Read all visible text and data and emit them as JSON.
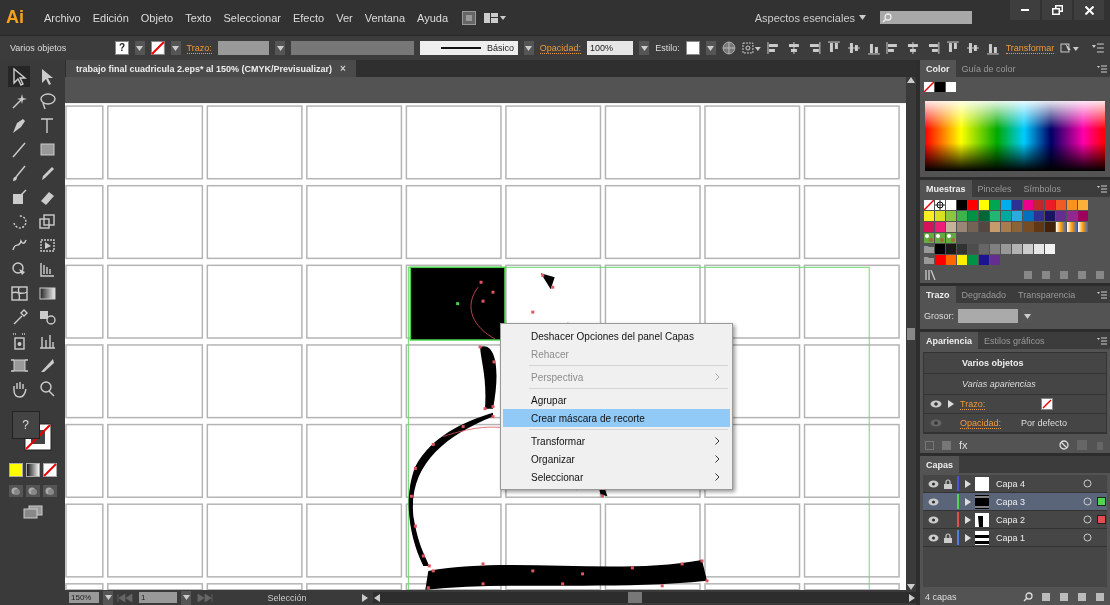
{
  "app_logo": "Ai",
  "menu": [
    "Archivo",
    "Edición",
    "Objeto",
    "Texto",
    "Seleccionar",
    "Efecto",
    "Ver",
    "Ventana",
    "Ayuda"
  ],
  "workspace": "Aspectos esenciales",
  "control_bar": {
    "selection": "Varios objetos",
    "fill_unknown": "?",
    "stroke_label": "Trazo:",
    "profile": "Básico",
    "opacity_label": "Opacidad:",
    "opacity": "100%",
    "style_label": "Estilo:",
    "transform": "Transformar"
  },
  "document_tab": {
    "title": "trabajo final cuadricula 2.eps* al 150% (CMYK/Previsualizar)",
    "close": "×"
  },
  "toolbar": {
    "fill_unknown": "?"
  },
  "context_menu": [
    {
      "kind": "item",
      "label": "Deshacer Opciones del panel Capas",
      "disabled": false,
      "submenu": false,
      "selected": false
    },
    {
      "kind": "item",
      "label": "Rehacer",
      "disabled": true,
      "submenu": false,
      "selected": false
    },
    {
      "kind": "separator"
    },
    {
      "kind": "item",
      "label": "Perspectiva",
      "disabled": true,
      "submenu": true,
      "selected": false
    },
    {
      "kind": "separator"
    },
    {
      "kind": "item",
      "label": "Agrupar",
      "disabled": false,
      "submenu": false,
      "selected": false
    },
    {
      "kind": "item",
      "label": "Crear máscara de recorte",
      "disabled": false,
      "submenu": false,
      "selected": true
    },
    {
      "kind": "separator"
    },
    {
      "kind": "item",
      "label": "Transformar",
      "disabled": false,
      "submenu": true,
      "selected": false
    },
    {
      "kind": "item",
      "label": "Organizar",
      "disabled": false,
      "submenu": true,
      "selected": false
    },
    {
      "kind": "item",
      "label": "Seleccionar",
      "disabled": false,
      "submenu": true,
      "selected": false
    }
  ],
  "color_panel": {
    "tabs": [
      {
        "label": "Color",
        "selected": true
      },
      {
        "label": "Guía de color",
        "selected": false
      }
    ]
  },
  "swatches_panel": {
    "tabs": [
      {
        "label": "Muestras",
        "selected": true
      },
      {
        "label": "Pinceles",
        "selected": false
      },
      {
        "label": "Símbolos",
        "selected": false
      }
    ],
    "rows": [
      [
        {
          "kind": "none"
        },
        {
          "kind": "registration"
        },
        {
          "kind": "color",
          "color": "#ffffff"
        },
        {
          "kind": "color",
          "color": "#000000"
        },
        {
          "kind": "color",
          "color": "#ff0000"
        },
        {
          "kind": "color",
          "color": "#ffff00"
        },
        {
          "kind": "color",
          "color": "#00a651"
        },
        {
          "kind": "color",
          "color": "#00aeef"
        },
        {
          "kind": "color",
          "color": "#2e3192"
        },
        {
          "kind": "color",
          "color": "#ec008c"
        },
        {
          "kind": "color",
          "color": "#c1272d"
        },
        {
          "kind": "color",
          "color": "#ed1c24"
        },
        {
          "kind": "color",
          "color": "#f15a24"
        },
        {
          "kind": "color",
          "color": "#f7931e"
        },
        {
          "kind": "color",
          "color": "#fbb03b"
        }
      ],
      [
        {
          "kind": "color",
          "color": "#fcee21"
        },
        {
          "kind": "color",
          "color": "#d9e021"
        },
        {
          "kind": "color",
          "color": "#8cc63f"
        },
        {
          "kind": "color",
          "color": "#39b54a"
        },
        {
          "kind": "color",
          "color": "#009245"
        },
        {
          "kind": "color",
          "color": "#006837"
        },
        {
          "kind": "color",
          "color": "#22b573"
        },
        {
          "kind": "color",
          "color": "#00a99d"
        },
        {
          "kind": "color",
          "color": "#29abe2"
        },
        {
          "kind": "color",
          "color": "#0071bc"
        },
        {
          "kind": "color",
          "color": "#2e3192"
        },
        {
          "kind": "color",
          "color": "#1b1464"
        },
        {
          "kind": "color",
          "color": "#662d91"
        },
        {
          "kind": "color",
          "color": "#93278f"
        },
        {
          "kind": "color",
          "color": "#9e005d"
        }
      ],
      [
        {
          "kind": "color",
          "color": "#d4145a"
        },
        {
          "kind": "color",
          "color": "#ed1e79"
        },
        {
          "kind": "color",
          "color": "#c7b299"
        },
        {
          "kind": "color",
          "color": "#998675"
        },
        {
          "kind": "color",
          "color": "#736357"
        },
        {
          "kind": "color",
          "color": "#534741"
        },
        {
          "kind": "color",
          "color": "#c69c6d"
        },
        {
          "kind": "color",
          "color": "#a67c52"
        },
        {
          "kind": "color",
          "color": "#8c6239"
        },
        {
          "kind": "color",
          "color": "#754c24"
        },
        {
          "kind": "color",
          "color": "#603813"
        },
        {
          "kind": "color",
          "color": "#42210b"
        },
        {
          "kind": "gradient"
        },
        {
          "kind": "gradient"
        },
        {
          "kind": "gradient"
        }
      ],
      [
        {
          "kind": "pattern"
        },
        {
          "kind": "pattern"
        },
        {
          "kind": "pattern"
        }
      ],
      [
        {
          "kind": "folder"
        },
        {
          "kind": "color",
          "color": "#000000"
        },
        {
          "kind": "color",
          "color": "#1a1a1a"
        },
        {
          "kind": "color",
          "color": "#333333"
        },
        {
          "kind": "color",
          "color": "#4d4d4d"
        },
        {
          "kind": "color",
          "color": "#666666"
        },
        {
          "kind": "color",
          "color": "#808080"
        },
        {
          "kind": "color",
          "color": "#999999"
        },
        {
          "kind": "color",
          "color": "#b3b3b3"
        },
        {
          "kind": "color",
          "color": "#cccccc"
        },
        {
          "kind": "color",
          "color": "#e6e6e6"
        },
        {
          "kind": "color",
          "color": "#f2f2f2"
        }
      ],
      [
        {
          "kind": "folder"
        },
        {
          "kind": "color",
          "color": "#ff0000"
        },
        {
          "kind": "color",
          "color": "#ff6600"
        },
        {
          "kind": "color",
          "color": "#ffee00"
        },
        {
          "kind": "color",
          "color": "#009245"
        },
        {
          "kind": "color",
          "color": "#1b1490"
        },
        {
          "kind": "color",
          "color": "#662d91"
        }
      ]
    ]
  },
  "stroke_panel": {
    "tabs": [
      {
        "label": "Trazo",
        "selected": true
      },
      {
        "label": "Degradado",
        "selected": false
      },
      {
        "label": "Transparencia",
        "selected": false
      }
    ],
    "weight_label": "Grosor:"
  },
  "appearance_panel": {
    "tabs": [
      {
        "label": "Apariencia",
        "selected": true
      },
      {
        "label": "Estilos gráficos",
        "selected": false
      }
    ],
    "title": "Varios objetos",
    "subtitle": "Varias apariencias",
    "rows": [
      {
        "kind": "stroke",
        "label": "Trazo:",
        "visible": true
      },
      {
        "kind": "opacity",
        "label": "Opacidad:",
        "value": "Por defecto",
        "visible": false
      }
    ],
    "fx": "fx"
  },
  "layers_panel": {
    "tab": "Capas",
    "layers": [
      {
        "name": "Capa 4",
        "visible": true,
        "locked": true,
        "color": "#4f4fe0",
        "selected": false,
        "has_selection": false
      },
      {
        "name": "Capa 3",
        "visible": true,
        "locked": false,
        "color": "#4fd84f",
        "selected": true,
        "has_selection": true
      },
      {
        "name": "Capa 2",
        "visible": true,
        "locked": false,
        "color": "#e04f4f",
        "selected": false,
        "has_selection": true
      },
      {
        "name": "Capa 1",
        "visible": true,
        "locked": true,
        "color": "#4f7fe0",
        "selected": false,
        "has_selection": false
      }
    ],
    "count": "4 capas"
  },
  "status_bar": {
    "zoom": "150%",
    "page": "1",
    "tool": "Selección"
  }
}
